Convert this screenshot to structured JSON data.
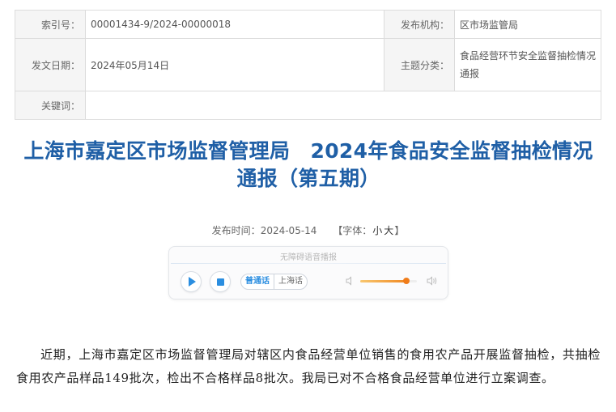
{
  "meta": {
    "index_label": "索引号：",
    "index_value": "00001434-9/2024-00000018",
    "issuer_label": "发布机构：",
    "issuer_value": "区市场监管局",
    "date_label": "发文日期：",
    "date_value": "2024年05月14日",
    "topic_label": "主题分类：",
    "topic_value": "食品经营环节安全监督抽检情况通报",
    "keywords_label": "关键词：",
    "keywords_value": ""
  },
  "article": {
    "title": "上海市嘉定区市场监督管理局　2024年食品安全监督抽检情况通报（第五期）",
    "publish_label": "发布时间：",
    "publish_time": "2024-05-14",
    "font_size_prefix": "【字体：",
    "font_small": "小",
    "font_large": "大",
    "font_size_suffix": "】",
    "body": "近期，上海市嘉定区市场监督管理局对辖区内食品经营单位销售的食用农产品开展监督抽检，共抽检食用农产品样品149批次，检出不合格样品8批次。我局已对不合格食品经营单位进行立案调查。"
  },
  "player": {
    "caption": "无障碍语音播报",
    "play_icon": "play-icon",
    "stop_icon": "stop-icon",
    "lang_mandarin": "普通话",
    "lang_shanghai": "上海话",
    "volume_level": 0.82,
    "accent_color": "#2b8ee0",
    "volume_color": "#f08a24"
  },
  "colors": {
    "title": "#1f5fa6",
    "label_bg": "#f5f5f5"
  }
}
